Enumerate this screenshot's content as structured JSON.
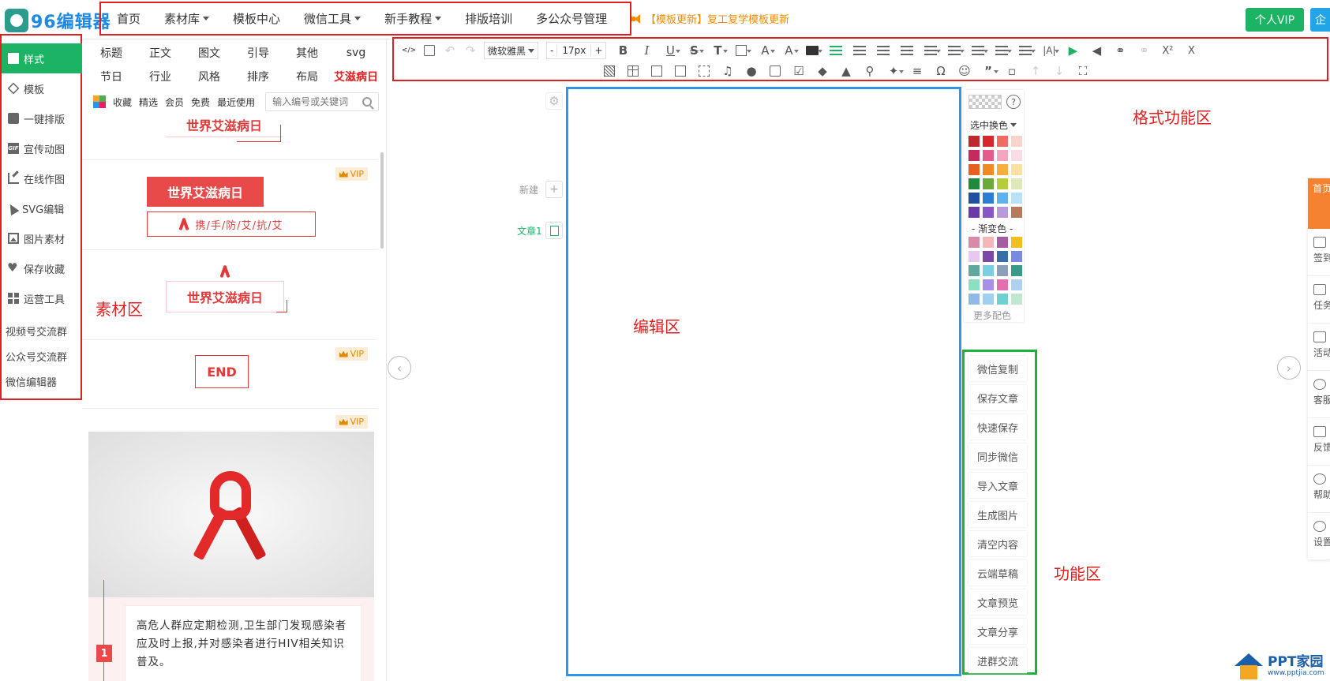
{
  "app": {
    "logo_text": "96编辑器"
  },
  "topnav": {
    "items": [
      {
        "label": "首页",
        "has_caret": false
      },
      {
        "label": "素材库",
        "has_caret": true
      },
      {
        "label": "模板中心",
        "has_caret": false
      },
      {
        "label": "微信工具",
        "has_caret": true
      },
      {
        "label": "新手教程",
        "has_caret": true
      },
      {
        "label": "排版培训",
        "has_caret": false
      },
      {
        "label": "多公众号管理",
        "has_caret": false
      }
    ],
    "notice": "【模板更新】复工复学模板更新",
    "vip_button": "个人VIP",
    "enterprise_button": "企"
  },
  "sidebar": {
    "items": [
      {
        "label": "样式",
        "icon": "grid-icon",
        "active": true
      },
      {
        "label": "模板",
        "icon": "layers-icon",
        "active": false
      },
      {
        "label": "一键排版",
        "icon": "document-icon",
        "active": false
      },
      {
        "label": "宣传动图",
        "icon": "gif-icon",
        "active": false
      },
      {
        "label": "在线作图",
        "icon": "pen-icon",
        "active": false
      },
      {
        "label": "SVG编辑",
        "icon": "cursor-icon",
        "active": false
      },
      {
        "label": "图片素材",
        "icon": "image-icon",
        "active": false
      },
      {
        "label": "保存收藏",
        "icon": "heart-icon",
        "active": false
      },
      {
        "label": "运营工具",
        "icon": "grid-icon",
        "active": false
      }
    ],
    "links": [
      "视频号交流群",
      "公众号交流群",
      "微信编辑器"
    ]
  },
  "material": {
    "categories": [
      "标题",
      "正文",
      "图文",
      "引导",
      "其他",
      "svg",
      "节日",
      "行业",
      "风格",
      "排序",
      "布局",
      "艾滋病日"
    ],
    "active_category": "艾滋病日",
    "filters": [
      "收藏",
      "精选",
      "会员",
      "免费",
      "最近使用"
    ],
    "search_placeholder": "输入编号或关键词",
    "vip_label": "VIP",
    "templates": {
      "t1_title": "世界艾滋病日",
      "t2_title": "世界艾滋病日",
      "t2_sub": "携/手/防/艾/抗/艾",
      "t3_title": "世界艾滋病日",
      "t4_title": "END",
      "t5_number": "1",
      "t5_text": "高危人群应定期检测,卫生部门发现感染者应及时上报,并对感染者进行HIV相关知识普及。"
    }
  },
  "toolbar": {
    "font_family": "微软雅黑",
    "font_size": "17px",
    "minus": "-",
    "plus": "+"
  },
  "editor": {
    "new_label": "新建",
    "article_label": "文章1"
  },
  "palette": {
    "mode_label": "选中换色",
    "gradient_label": "- 渐变色 -",
    "more_label": "更多配色",
    "solid_colors": [
      "#c0282f",
      "#d8262c",
      "#ef6b64",
      "#f9d4cc",
      "#c62a5c",
      "#e45c8c",
      "#f4a6c0",
      "#f9dde6",
      "#e8601e",
      "#f08a24",
      "#f7ae3c",
      "#fbe0a4",
      "#1f8a3a",
      "#6aaa3a",
      "#b7cc3a",
      "#dfe9b8",
      "#1f4fa0",
      "#2a7fd4",
      "#5fb2ee",
      "#b8e0f7",
      "#6a3aa8",
      "#8a55c4",
      "#b89ad8",
      "#b57a5c"
    ],
    "gradient_colors": [
      "#d98aa6",
      "#f4b6b6",
      "#a45fa0",
      "#f0c020",
      "#e9c8f0",
      "#7a4aa8",
      "#3a6ea8",
      "#7a8ae0",
      "#5fa8a0",
      "#7ad0e0",
      "#8aa0b8",
      "#3a9a8a",
      "#8ae0c0",
      "#a890e8",
      "#e070b0",
      "#b0d0f0",
      "#90b8e8",
      "#a0d0f0",
      "#70d0d0",
      "#c0e8d0"
    ]
  },
  "functions": [
    "微信复制",
    "保存文章",
    "快速保存",
    "同步微信",
    "导入文章",
    "生成图片",
    "清空内容",
    "云端草稿",
    "文章预览",
    "文章分享",
    "进群交流"
  ],
  "zones": {
    "format": "格式功能区",
    "material": "素材区",
    "editor": "编辑区",
    "function": "功能区"
  },
  "right_rail": {
    "top": "首页制作",
    "items": [
      "签到",
      "任务",
      "活动",
      "客服",
      "反馈",
      "帮助",
      "设置"
    ]
  },
  "watermark": {
    "text": "PPT家园",
    "sub": "www.pptjia.com"
  }
}
